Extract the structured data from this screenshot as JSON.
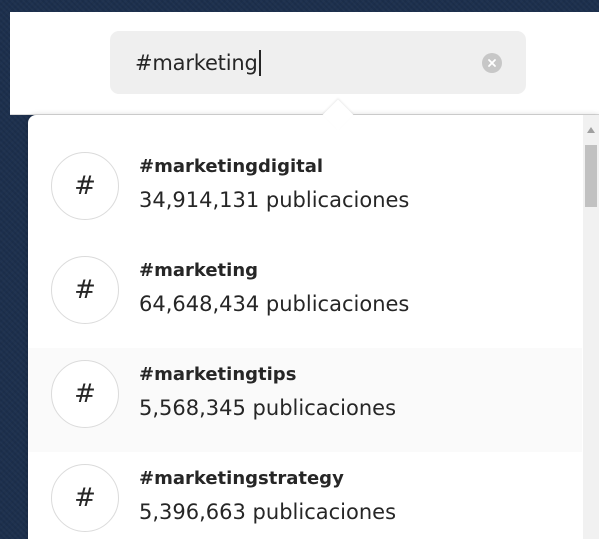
{
  "search": {
    "value": "#marketing",
    "clear_icon": "clear-circle-icon"
  },
  "results": [
    {
      "icon": "hashtag-icon",
      "symbol": "#",
      "name": "#marketingdigital",
      "count": "34,914,131 publicaciones"
    },
    {
      "icon": "hashtag-icon",
      "symbol": "#",
      "name": "#marketing",
      "count": "64,648,434 publicaciones"
    },
    {
      "icon": "hashtag-icon",
      "symbol": "#",
      "name": "#marketingtips",
      "count": "5,568,345 publicaciones",
      "highlighted": true
    },
    {
      "icon": "hashtag-icon",
      "symbol": "#",
      "name": "#marketingstrategy",
      "count": "5,396,663 publicaciones"
    }
  ],
  "colors": {
    "frame": "#1c2f4d",
    "text": "#262626",
    "search_bg": "#efefef",
    "hover_row": "#fafafa"
  }
}
